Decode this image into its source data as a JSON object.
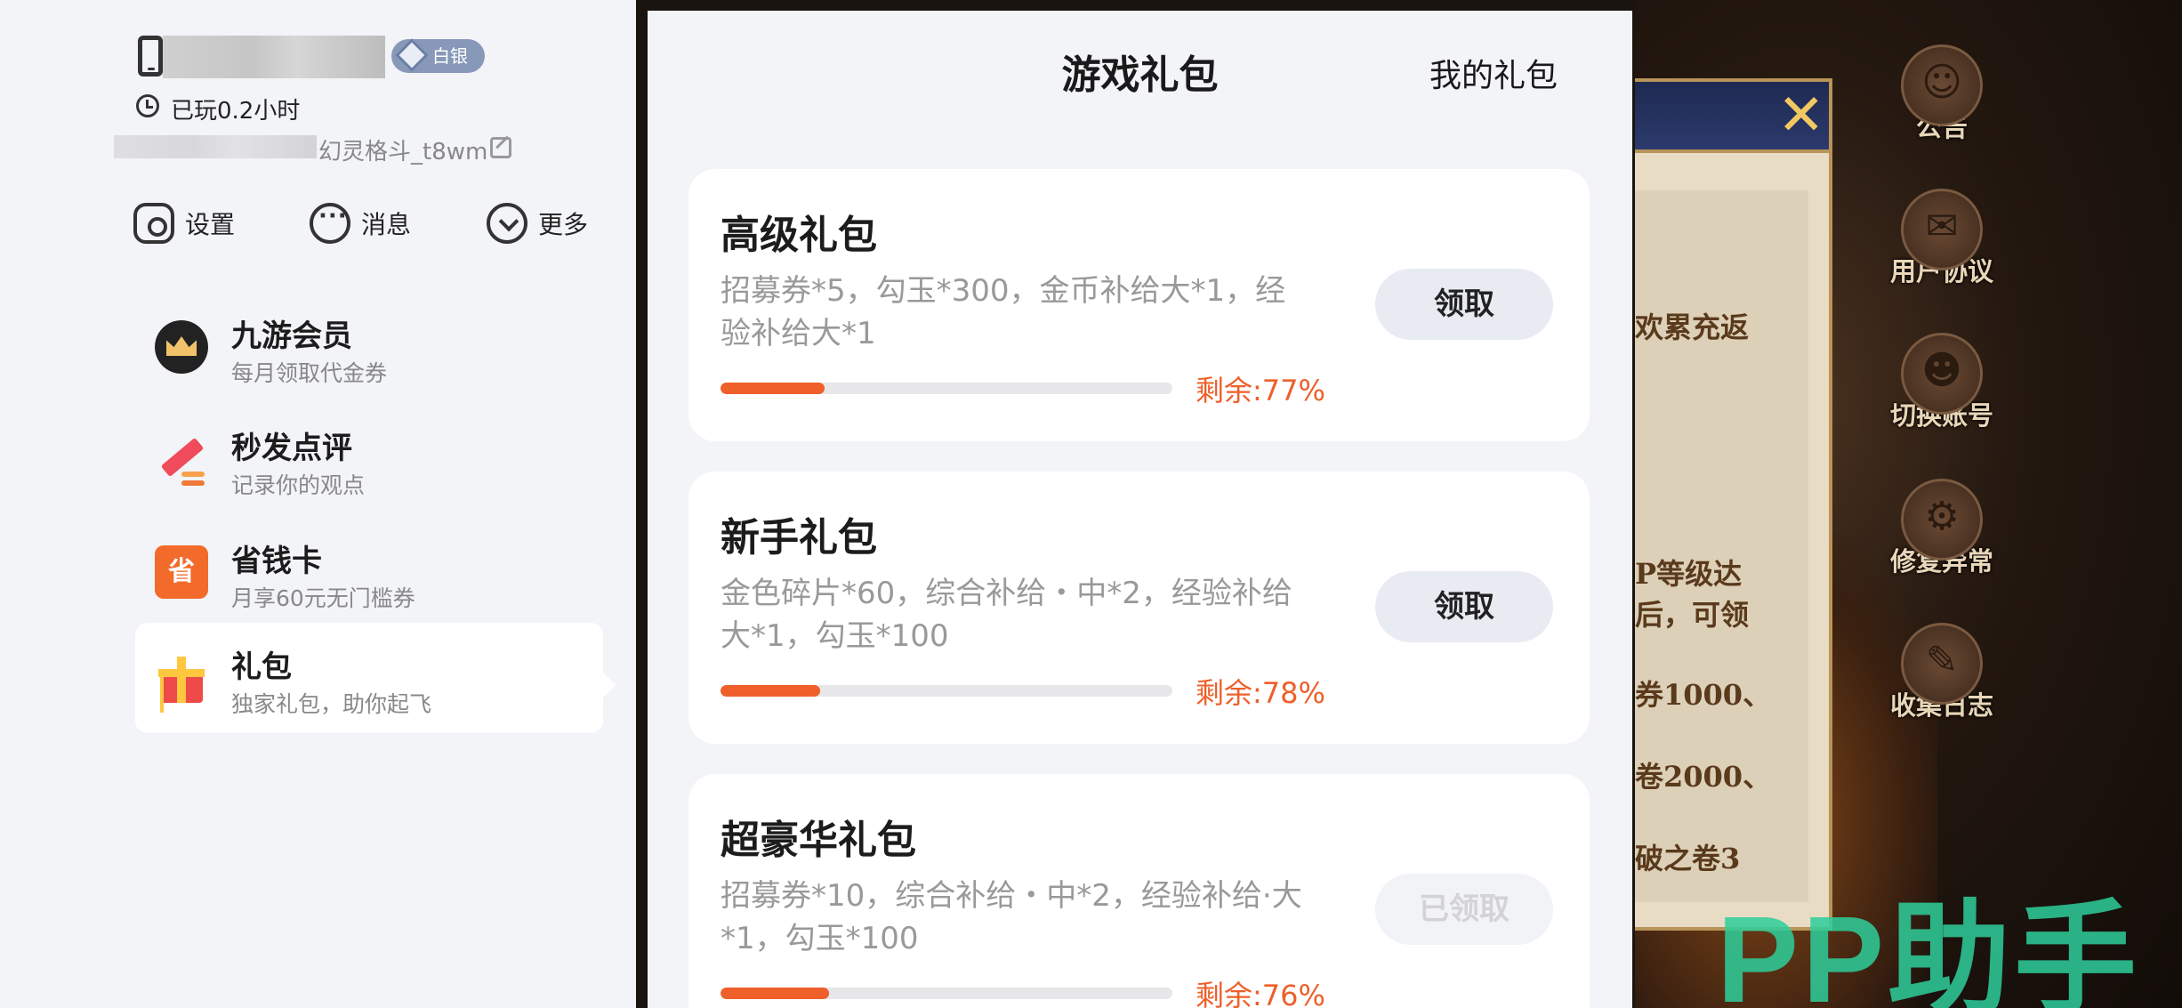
{
  "profile": {
    "badge_label": "白银",
    "played": "已玩0.2小时",
    "game_id": "幻灵格斗_t8wm"
  },
  "actions": {
    "settings": "设置",
    "messages": "消息",
    "more": "更多"
  },
  "menu": [
    {
      "title": "九游会员",
      "subtitle": "每月领取代金券",
      "icon": "vip-crown-icon"
    },
    {
      "title": "秒发点评",
      "subtitle": "记录你的观点",
      "icon": "pen-icon"
    },
    {
      "title": "省钱卡",
      "subtitle": "月享60元无门槛券",
      "icon": "save-card-icon",
      "icon_text": "省"
    },
    {
      "title": "礼包",
      "subtitle": "独家礼包，助你起飞",
      "icon": "gift-icon",
      "active": true
    }
  ],
  "panel": {
    "title": "游戏礼包",
    "my_gifts": "我的礼包"
  },
  "gifts": [
    {
      "name": "高级礼包",
      "desc": "招募券*5，勾玉*300，金币补给大*1，经验补给大*1",
      "remaining_label": "剩余:77%",
      "progress": 0.23,
      "button": "领取",
      "claimed": false
    },
    {
      "name": "新手礼包",
      "desc": "金色碎片*60，综合补给・中*2，经验补给大*1，勾玉*100",
      "remaining_label": "剩余:78%",
      "progress": 0.22,
      "button": "领取",
      "claimed": false
    },
    {
      "name": "超豪华礼包",
      "desc": "招募券*10，综合补给・中*2，经验补给·大*1，勾玉*100",
      "remaining_label": "剩余:76%",
      "progress": 0.24,
      "button": "已领取",
      "claimed": true
    }
  ],
  "game": {
    "scroll_text": [
      "欢累充返",
      "P等级达",
      "后，可领",
      "券1000、",
      "卷2000、",
      "破之卷3"
    ],
    "side_buttons": [
      {
        "label": "公告",
        "icon": "notice-icon"
      },
      {
        "label": "用户协议",
        "icon": "scroll-icon"
      },
      {
        "label": "切换账号",
        "icon": "switch-account-icon"
      },
      {
        "label": "修复异常",
        "icon": "wrench-gear-icon"
      },
      {
        "label": "收集日志",
        "icon": "log-icon"
      }
    ],
    "close_symbol": "✕"
  },
  "watermark": "PP助手",
  "colors": {
    "accent_orange": "#ee5f2a",
    "watermark_green": "#2ecf9c",
    "badge_silver": "#8898b8"
  }
}
